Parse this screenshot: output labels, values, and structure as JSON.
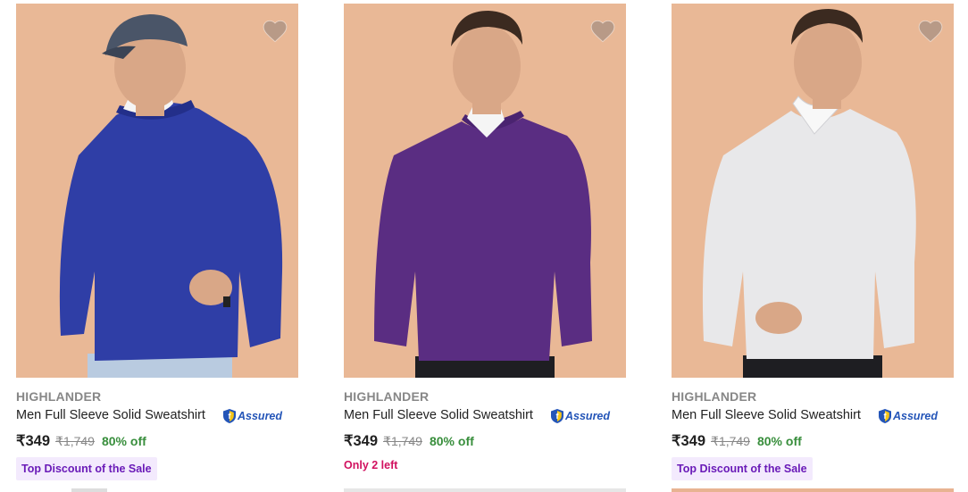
{
  "products": [
    {
      "brand": "HIGHLANDER",
      "title": "Men Full Sleeve Solid Sweatshirt",
      "assured": "Assured",
      "price": "₹349",
      "mrp": "₹1,749",
      "discount": "80% off",
      "tag": "Top Discount of the Sale",
      "sweatshirt_color": "#2f3ea6",
      "image_icon": "product-photo-blue-sweatshirt",
      "wishlist_icon": "heart-icon"
    },
    {
      "brand": "HIGHLANDER",
      "title": "Men Full Sleeve Solid Sweatshirt",
      "assured": "Assured",
      "price": "₹349",
      "mrp": "₹1,749",
      "discount": "80% off",
      "stock_note": "Only 2 left",
      "sweatshirt_color": "#5a2d82",
      "image_icon": "product-photo-purple-sweatshirt",
      "wishlist_icon": "heart-icon"
    },
    {
      "brand": "HIGHLANDER",
      "title": "Men Full Sleeve Solid Sweatshirt",
      "assured": "Assured",
      "price": "₹349",
      "mrp": "₹1,749",
      "discount": "80% off",
      "tag": "Top Discount of the Sale",
      "sweatshirt_color": "#e8e8ea",
      "image_icon": "product-photo-white-sweatshirt",
      "wishlist_icon": "heart-icon"
    }
  ],
  "colors": {
    "image_background": "#e9b896",
    "discount_green": "#388e3c",
    "tag_purple": "#6a1bb8",
    "tag_background": "#f3eafd",
    "low_stock_pink": "#d1115f",
    "assured_blue": "#2455b8"
  }
}
